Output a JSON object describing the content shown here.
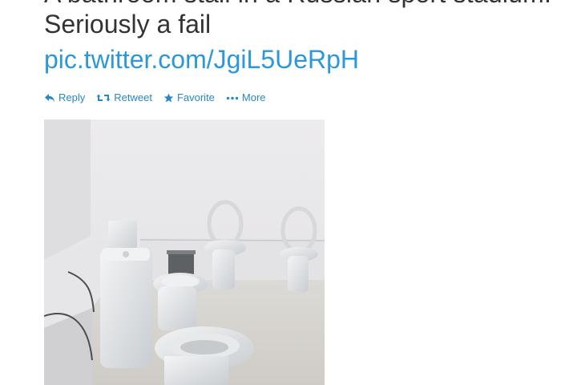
{
  "tweet": {
    "text_cut": "A bathroom stall in a Russian sport stadium.",
    "text": "Seriously a fail",
    "link": "pic.twitter.com/JgiL5UeRpH"
  },
  "actions": {
    "reply": "Reply",
    "retweet": "Retweet",
    "favorite": "Favorite",
    "more": "More"
  },
  "media": {
    "subject": "Photo of a white tiled bathroom with several toilets side by side without stalls"
  },
  "colors": {
    "link": "#2a98d9",
    "action": "#2a86c6",
    "text": "#333333"
  }
}
